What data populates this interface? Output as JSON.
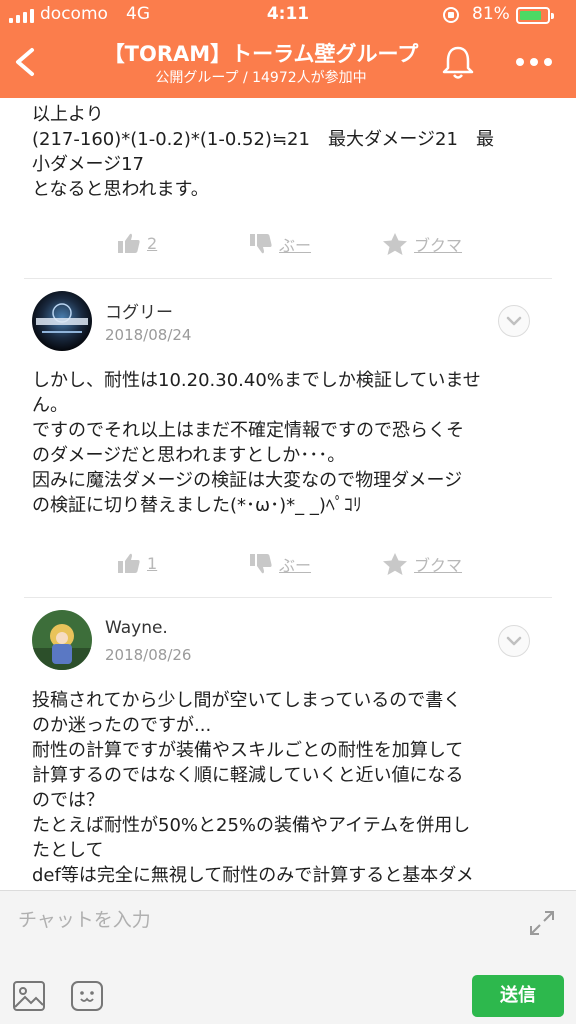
{
  "status_bar": {
    "carrier": "docomo",
    "network": "4G",
    "time": "4:11",
    "battery_percent": "81%",
    "battery_level": 0.81
  },
  "header": {
    "title": "【TORAM】トーラム壁グループ",
    "subtitle": "公開グループ / 14972人が参加中",
    "icons": [
      "back-icon",
      "bell-icon",
      "more-icon"
    ]
  },
  "colors": {
    "header_bg": "#fb7d4c",
    "send_button": "#2db84d",
    "action_gray": "#b8b8b8"
  },
  "posts": [
    {
      "lines": [
        "以上より",
        "(217-160)*(1-0.2)*(1-0.52)≒21　最大ダメージ21　最",
        "小ダメージ17",
        "となると思われます。"
      ],
      "likes": "2",
      "boo_label": "ぶー",
      "bookmark_label": "ブクマ"
    },
    {
      "author": "コグリー",
      "date": "2018/08/24",
      "lines": [
        "しかし、耐性は10.20.30.40%までしか検証していませ",
        "ん。",
        "ですのでそれ以上はまだ不確定情報ですので恐らくそ",
        "のダメージだと思われますとしか･･･。",
        "因みに魔法ダメージの検証は大変なので物理ダメージ",
        "の検証に切り替えました(*･ω･)*_ _)ﾍﾟｺﾘ"
      ],
      "likes": "1",
      "boo_label": "ぶー",
      "bookmark_label": "ブクマ"
    },
    {
      "author": "Wayne.",
      "date": "2018/08/26",
      "lines": [
        "投稿されてから少し間が空いてしまっているので書く",
        "のか迷ったのですが...",
        "耐性の計算ですが装備やスキルごとの耐性を加算して",
        "計算するのではなく順に軽減していくと近い値になる",
        "のでは？",
        "たとえば耐性が50%と25%の装備やアイテムを併用し",
        "たとして",
        "def等は完全に無視して耐性のみで計算すると基本ダメ"
      ]
    }
  ],
  "composer": {
    "placeholder": "チャットを入力",
    "send_label": "送信"
  }
}
